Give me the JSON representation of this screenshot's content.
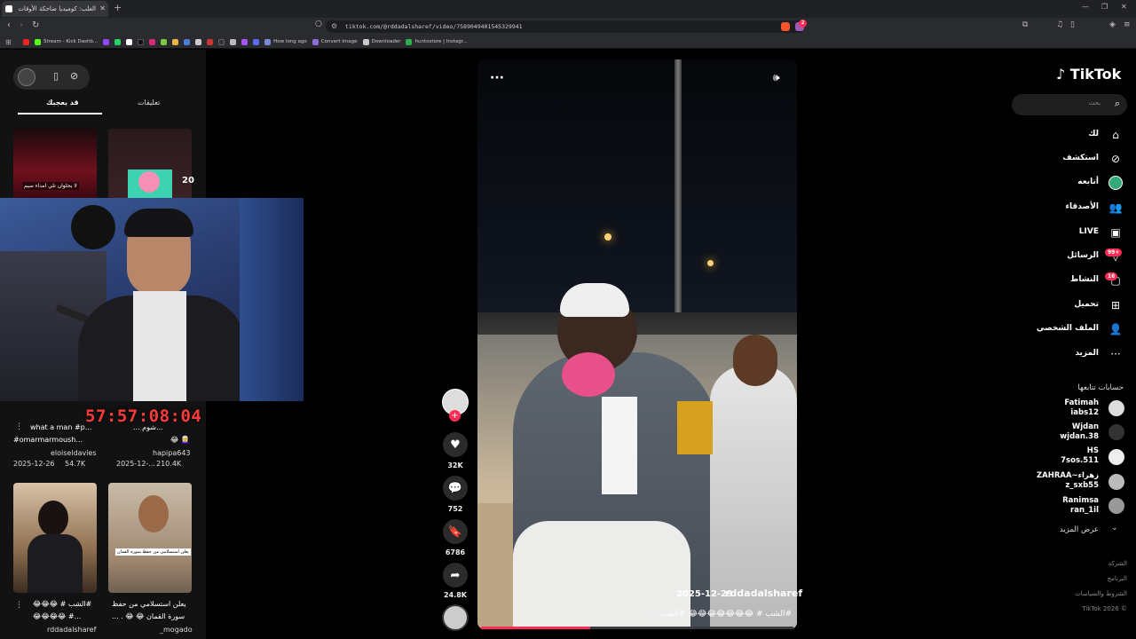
{
  "browser": {
    "tab_title": "الغلب: كوميديا ضاحكة الأوقات",
    "url": "tiktok.com/@rddadalsharef/video/7589049401545329941",
    "bookmarks": [
      "Stream - Kick Dashb...",
      "How long ago",
      "Convert Image",
      "Downloader",
      "huntostore | Instagr..."
    ],
    "notif_count": "2"
  },
  "left_panel": {
    "tabs": [
      "تعليقات",
      "قد يعجبك"
    ],
    "thumb_top_right_count": "20",
    "thumb_top_left_overlay": "لا يحلوان تلي امداء سيم",
    "videos": [
      {
        "caption": "what a man #p...",
        "caption2": "#omarmarmoush...",
        "author": "eloiseldavies",
        "date": "2025-12-26",
        "likes": "54.7K"
      },
      {
        "caption": "... شوم...",
        "caption2": "😂 👩‍🦳",
        "author": "hapipa643",
        "date": "2025-12-...",
        "likes": "210.4K"
      },
      {
        "caption": "#الشب # 😂😂😂",
        "caption2": "...# 😂😂😂😂",
        "author": "rddadalsharef",
        "date": "",
        "likes": ""
      },
      {
        "caption": "يعلن استسلامي من حفظ",
        "caption2": "سورة القمان 😂 😂 . ...",
        "author": "_mogado",
        "date": "",
        "likes": ""
      }
    ],
    "thumb_overlay_text": "يعلن استسلامي من حفظ سورة القمان"
  },
  "overlay": {
    "timer": "57:57:08:04"
  },
  "video": {
    "author": "rddadalsharef",
    "date": "2025-12-29",
    "caption": "#الشب # 😂😂😂😂😂😂😂 #الشب ...",
    "progress_percent": 35
  },
  "actions": {
    "likes": "32K",
    "comments": "752",
    "saves": "6786",
    "shares": "24.8K"
  },
  "sidebar": {
    "logo": "TikTok",
    "search_placeholder": "بحث",
    "nav": [
      {
        "label": "لك",
        "icon": "home-icon"
      },
      {
        "label": "استكشف",
        "icon": "compass-icon"
      },
      {
        "label": "أتابعه",
        "icon": "following-icon"
      },
      {
        "label": "الأصدقاء",
        "icon": "friends-icon"
      },
      {
        "label": "LIVE",
        "icon": "live-icon"
      },
      {
        "label": "الرسائل",
        "icon": "inbox-icon",
        "badge": "99+"
      },
      {
        "label": "النشاط",
        "icon": "activity-icon",
        "badge": "16"
      },
      {
        "label": "تحميل",
        "icon": "upload-icon"
      },
      {
        "label": "الملف الشخصي",
        "icon": "profile-icon"
      },
      {
        "label": "المزيد",
        "icon": "more-icon"
      }
    ],
    "following_header": "حسابات تتابعها",
    "following": [
      {
        "name": "Fatimah",
        "handle": "iabs12"
      },
      {
        "name": "Wjdan",
        "handle": "wjdan.38"
      },
      {
        "name": "HS",
        "handle": "7sos.511"
      },
      {
        "name": "ZAHRAA~زهراء",
        "handle": "z_sxb55"
      },
      {
        "name": "Ranimsa",
        "handle": "ran_1il"
      }
    ],
    "see_more": "عرض المزيد",
    "footer": [
      "الشركة",
      "البرنامج",
      "الشروط والسياسات",
      "TikTok 2026 ©"
    ]
  }
}
